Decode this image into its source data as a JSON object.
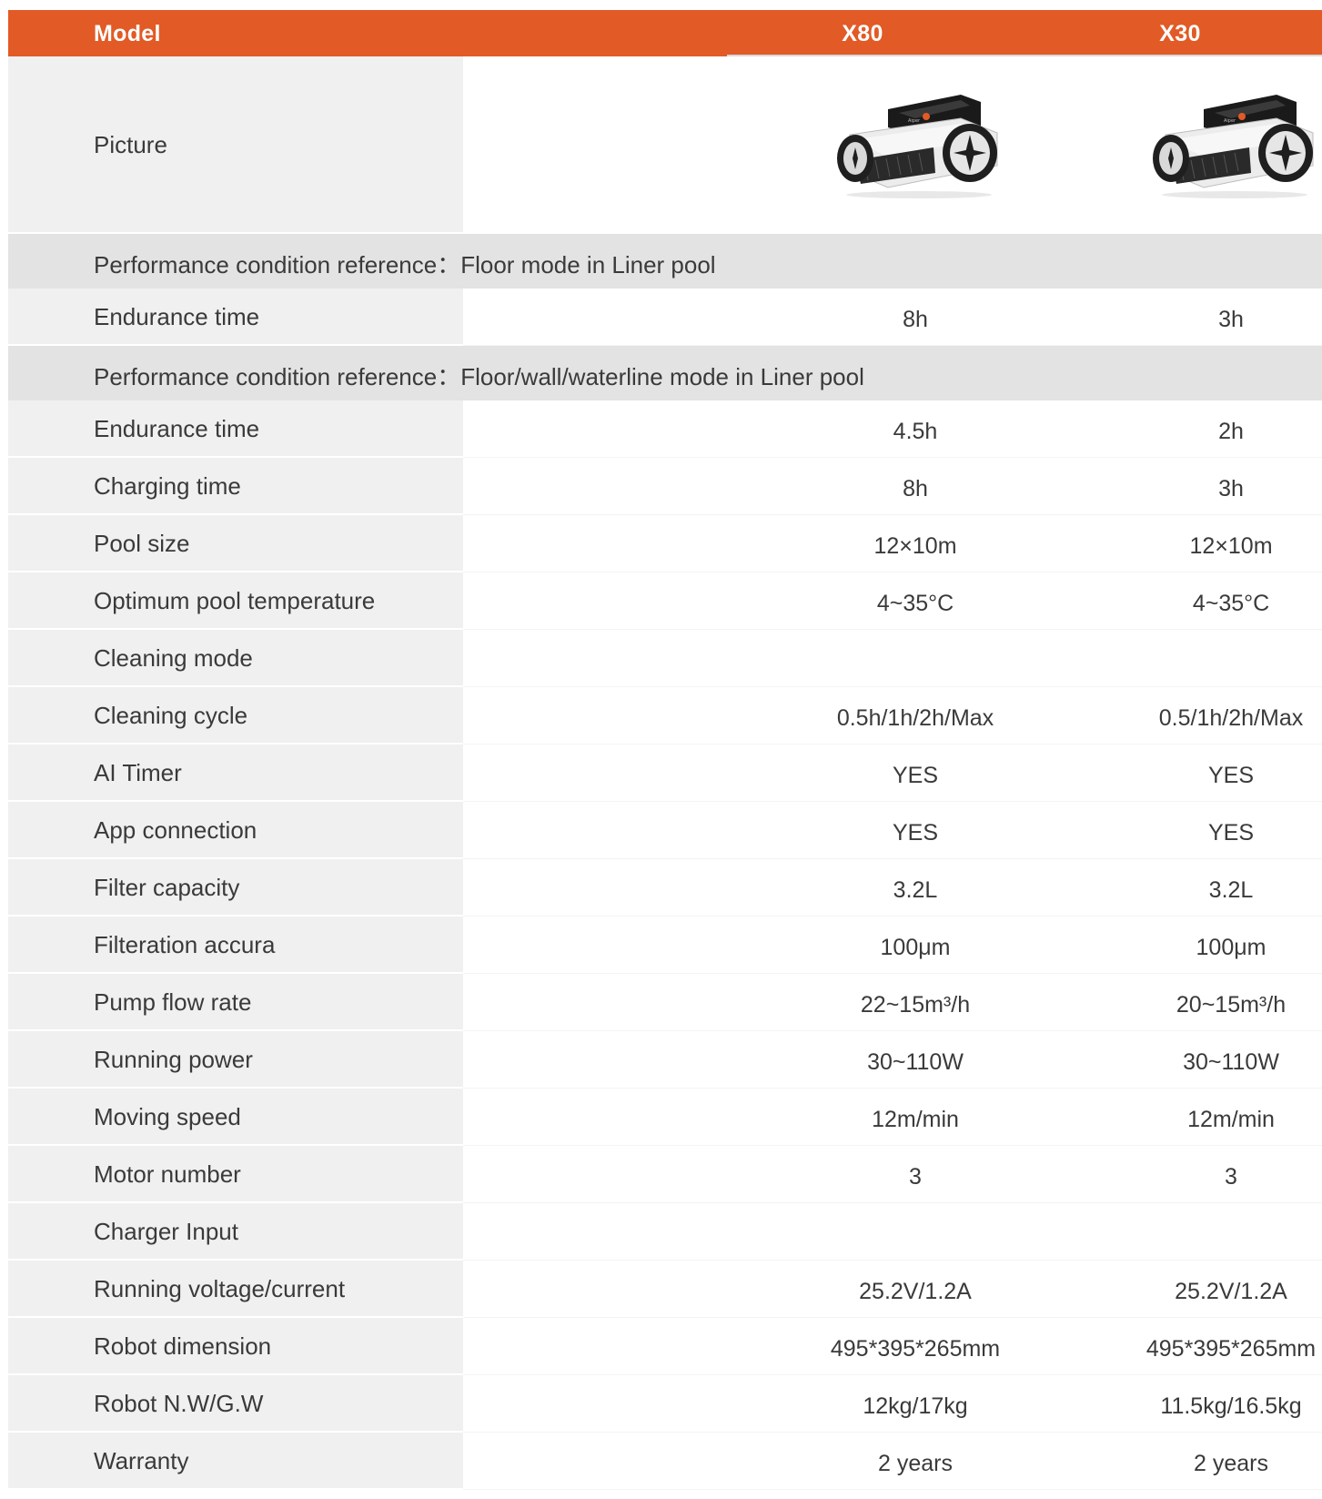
{
  "header": {
    "model_label": "Model",
    "col_a": "X80",
    "col_b": "X30"
  },
  "picture_label": "Picture",
  "robot_image": {
    "icon": "pool-robot-icon",
    "brand_text": "Aiper"
  },
  "section_1": "Performance condition reference：Floor mode in Liner pool",
  "row_endurance_1": {
    "label": "Endurance time",
    "a": "8h",
    "b": "3h"
  },
  "section_2": "Performance condition reference：Floor/wall/waterline mode in Liner pool",
  "rows": [
    {
      "label": "Endurance time",
      "a": "4.5h",
      "b": "2h"
    },
    {
      "label": "Charging time",
      "a": "8h",
      "b": "3h"
    },
    {
      "label": "Pool size",
      "a": "12×10m",
      "b": "12×10m"
    },
    {
      "label": "Optimum pool temperature",
      "a": "4~35°C",
      "b": "4~35°C"
    },
    {
      "label": "Cleaning mode",
      "a": "",
      "b": ""
    },
    {
      "label": "Cleaning cycle",
      "a": "0.5h/1h/2h/Max",
      "b": "0.5/1h/2h/Max"
    },
    {
      "label": "AI Timer",
      "a": "YES",
      "b": "YES"
    },
    {
      "label": "App connection",
      "a": "YES",
      "b": "YES"
    },
    {
      "label": "Filter capacity",
      "a": "3.2L",
      "b": "3.2L"
    },
    {
      "label": "Filteration accura",
      "a": "100μm",
      "b": "100μm"
    },
    {
      "label": "Pump flow rate",
      "a": "22~15m³/h",
      "b": "20~15m³/h"
    },
    {
      "label": "Running power",
      "a": "30~110W",
      "b": "30~110W"
    },
    {
      "label": "Moving speed",
      "a": "12m/min",
      "b": "12m/min"
    },
    {
      "label": "Motor number",
      "a": "3",
      "b": "3"
    },
    {
      "label": "Charger Input",
      "a": "",
      "b": ""
    },
    {
      "label": "Running voltage/current",
      "a": "25.2V/1.2A",
      "b": "25.2V/1.2A"
    },
    {
      "label": "Robot dimension",
      "a": "495*395*265mm",
      "b": "495*395*265mm"
    },
    {
      "label": "Robot N.W/G.W",
      "a": "12kg/17kg",
      "b": "11.5kg/16.5kg"
    },
    {
      "label": "Warranty",
      "a": "2 years",
      "b": "2 years"
    }
  ],
  "colors": {
    "header_bg": "#e25a26",
    "label_bg": "#f0f0f0",
    "section_bg": "#e3e3e3",
    "text": "#3a3a3a"
  }
}
